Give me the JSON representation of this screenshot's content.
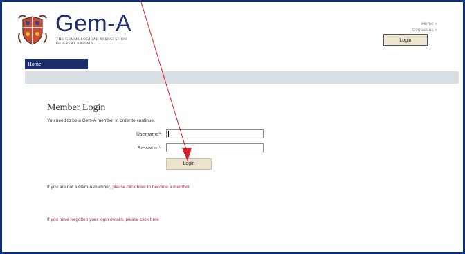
{
  "header": {
    "logo_text": "Gem-A",
    "tagline_line1": "THE GEMMOLOGICAL ASSOCIATION",
    "tagline_line2": "OF GREAT BRITAIN",
    "home_link": "Home »",
    "contact_link": "Contact us »",
    "login_button": "Login"
  },
  "nav": {
    "home_tab": "Home"
  },
  "login_form": {
    "title": "Member Login",
    "intro": "You need to be a Gem-A member in order to continue.",
    "username_label": "Username*:",
    "username_value": "",
    "password_label": "Password*:",
    "password_value": "",
    "submit_label": "Login"
  },
  "footer_links": {
    "not_member_text": "If you are not a Gem-A member,",
    "become_member_link": "please click here to become a member",
    "forgot_text": "If you have forgotten your login details, please click here"
  },
  "colors": {
    "frame_border": "#0d2f7a",
    "nav_tab": "#1c2e6b",
    "nav_bar": "#d9dee2",
    "link": "#b22754",
    "annotation_arrow": "#d0202a"
  }
}
